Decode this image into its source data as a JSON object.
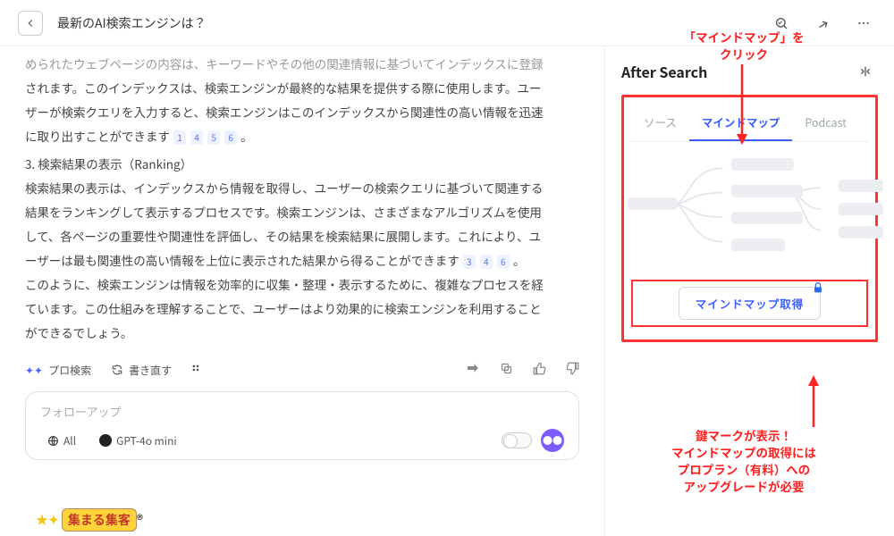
{
  "header": {
    "title": "最新のAI検索エンジンは？"
  },
  "article": {
    "p1_dim": "められたウェブページの内容は、キーワードやその他の関連情報に基づいてインデックスに登録",
    "p1_line2": "されます。このインデックスは、検索エンジンが最終的な結果を提供する際に使用します。ユー",
    "p1_line3": "ザーが検索クエリを入力すると、検索エンジンはこのインデックスから関連性の高い情報を迅速",
    "p1_line4_pre": "に取り出すことができます",
    "p1_line4_post": "。",
    "cites1": [
      "1",
      "4",
      "5",
      "6"
    ],
    "section3_title": "3. 検索結果の表示（Ranking）",
    "p2_line1": "検索結果の表示は、インデックスから情報を取得し、ユーザーの検索クエリに基づいて関連する",
    "p2_line2": "結果をランキングして表示するプロセスです。検索エンジンは、さまざまなアルゴリズムを使用",
    "p2_line3": "して、各ページの重要性や関連性を評価し、その結果を検索結果に展開します。これにより、ユ",
    "p2_line4_pre": "ーザーは最も関連性の高い情報を上位に表示された結果から得ることができます",
    "p2_line4_post": "。",
    "cites2": [
      "3",
      "4",
      "6"
    ],
    "p3_line1": "このように、検索エンジンは情報を効率的に収集・整理・表示するために、複雑なプロセスを経",
    "p3_line2": "ています。この仕組みを理解することで、ユーザーはより効果的に検索エンジンを利用すること",
    "p3_line3": "ができるでしょう。"
  },
  "toolbar": {
    "pro_search": "プロ検索",
    "rewrite": "書き直す"
  },
  "followup": {
    "placeholder": "フォローアップ",
    "all": "All",
    "model": "GPT-4o mini"
  },
  "side": {
    "panel_title": "After Search",
    "tabs": {
      "source": "ソース",
      "mindmap": "マインドマップ",
      "podcast": "Podcast"
    },
    "get_mindmap": "マインドマップ取得"
  },
  "annotations": {
    "top": "「マインドマップ」を\nクリック",
    "bottom": "鍵マークが表示！\nマインドマップの取得には\nプロプラン（有料）への\nアップグレードが必要"
  },
  "logo": {
    "text": "集まる集客"
  }
}
